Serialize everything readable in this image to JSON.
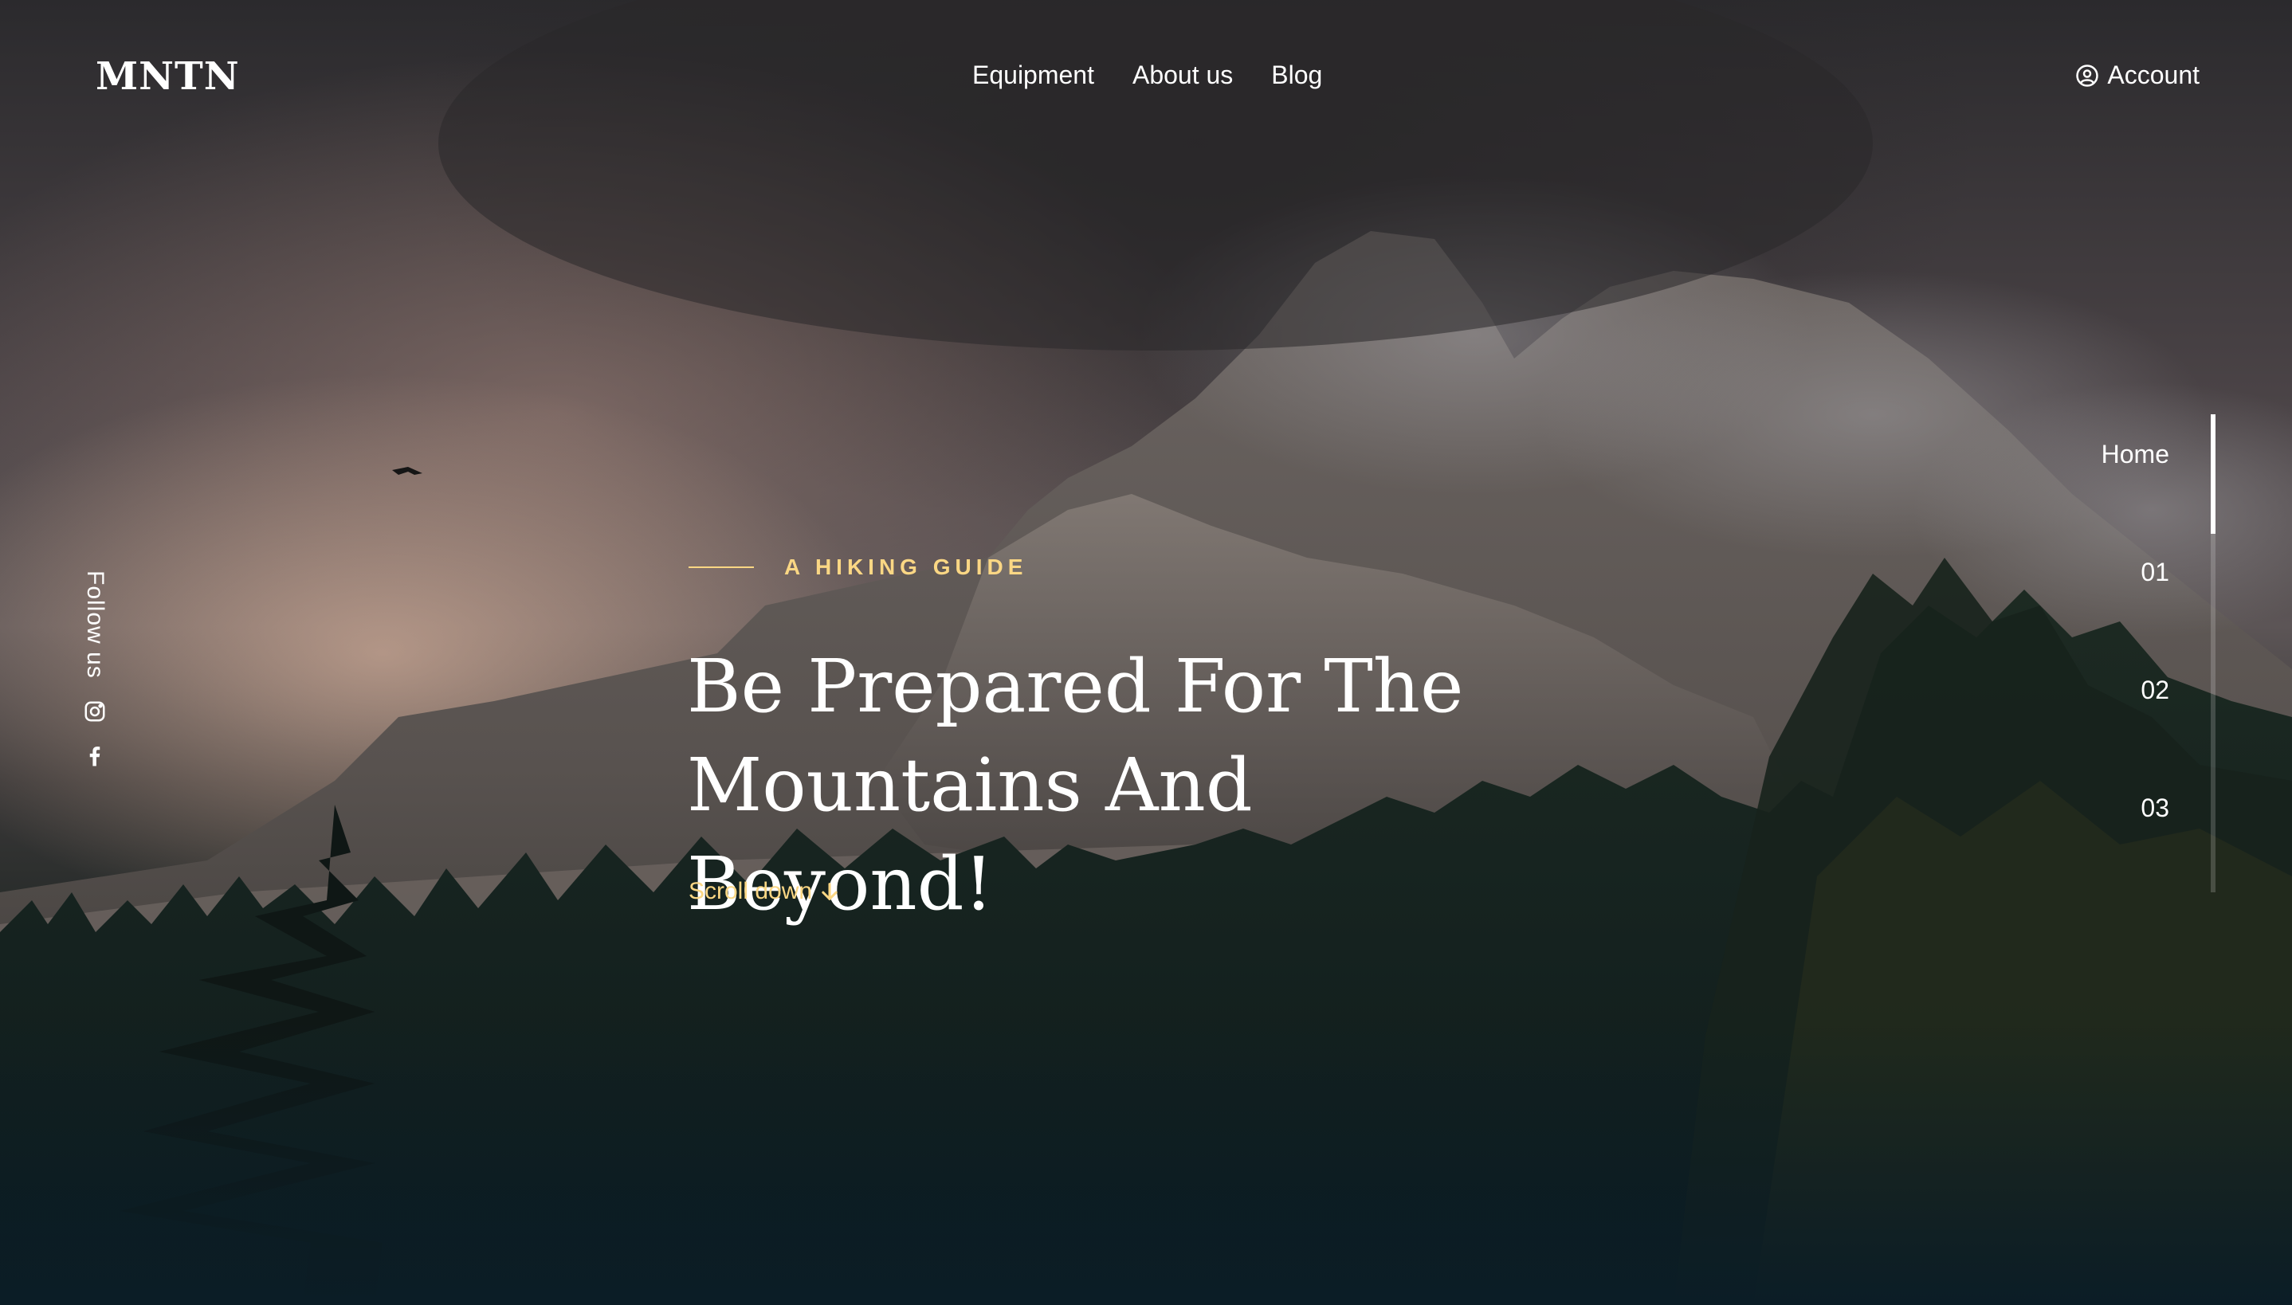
{
  "header": {
    "logo": "MNTN",
    "nav": [
      "Equipment",
      "About us",
      "Blog"
    ],
    "account_label": "Account",
    "account_icon": "user-circle-icon"
  },
  "follow": {
    "label": "Follow us",
    "icons": [
      "instagram-icon",
      "facebook-icon"
    ]
  },
  "hero": {
    "eyebrow": "A HIKING GUIDE",
    "headline_line1": "Be Prepared For The",
    "headline_line2": "Mountains And Beyond!",
    "scroll_label": "Scroll down",
    "scroll_icon": "arrow-down-icon"
  },
  "slides": {
    "items": [
      "Home",
      "01",
      "02",
      "03"
    ],
    "active_index": 0
  },
  "colors": {
    "accent": "#fbd784",
    "text": "#ffffff",
    "bottom": "#0b1d26"
  }
}
